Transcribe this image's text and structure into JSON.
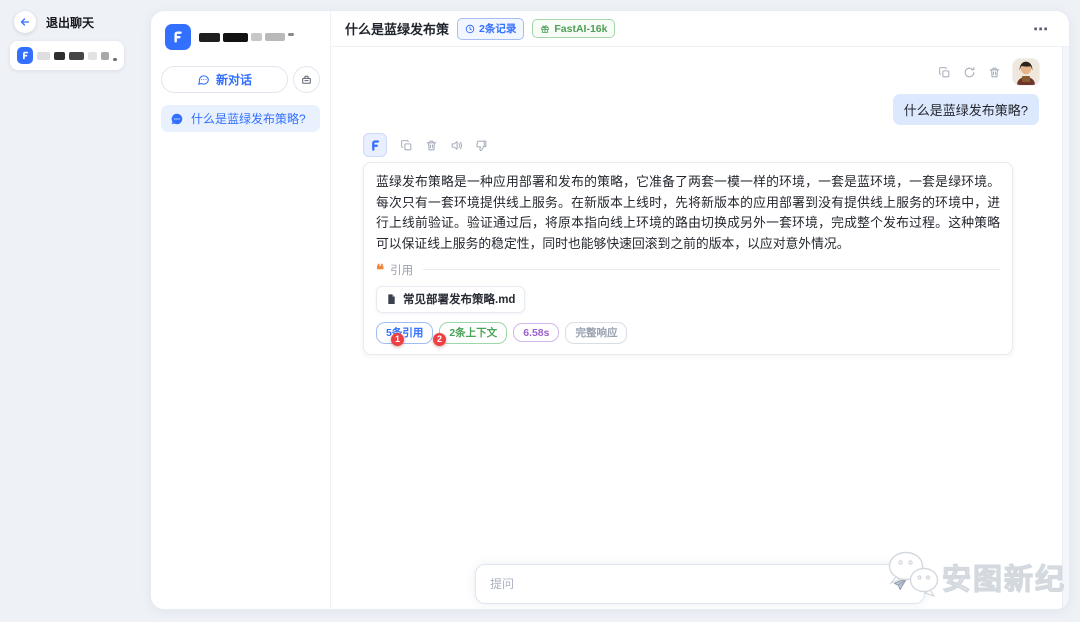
{
  "colors": {
    "accent_blue": "#3370ff",
    "badge_green": "#4f9e57",
    "badge_purple": "#9a5fd0",
    "badge_gray": "#9aa2b0",
    "marker_red": "#ee3f42",
    "user_bubble_bg": "#dbe8fd",
    "history_item_bg": "#e9f1fe",
    "page_bg": "#eef1f6"
  },
  "icons": {
    "back": "arrow-left-icon",
    "new_chat": "chat-bubble-icon",
    "clear": "box-icon",
    "history": "chat-bubble-filled-icon",
    "records": "clock-icon",
    "model": "gift-icon",
    "menu": "ellipsis-icon",
    "copy": "copy-icon",
    "retry": "refresh-icon",
    "delete": "trash-icon",
    "speak": "speaker-icon",
    "dislike": "thumbs-down-icon",
    "file": "document-icon",
    "send": "paper-plane-icon",
    "watermark": "wechat-bubbles-icon"
  },
  "left_rail": {
    "exit_label": "退出聊天"
  },
  "sidebar": {
    "new_chat_label": "新对话",
    "history": [
      {
        "label": "什么是蓝绿发布策略?"
      }
    ]
  },
  "header": {
    "title": "什么是蓝绿发布策",
    "records_badge": "2条记录",
    "model_badge": "FastAI-16k",
    "menu": "⋯"
  },
  "chat": {
    "user_message": "什么是蓝绿发布策略?",
    "assistant_message": "蓝绿发布策略是一种应用部署和发布的策略，它准备了两套一模一样的环境，一套是蓝环境，一套是绿环境。每次只有一套环境提供线上服务。在新版本上线时，先将新版本的应用部署到没有提供线上服务的环境中，进行上线前验证。验证通过后，将原本指向线上环境的路由切换成另外一套环境，完成整个发布过程。这种策略可以保证线上服务的稳定性，同时也能够快速回滚到之前的版本，以应对意外情况。",
    "quote_label": "引用",
    "citation_file": "常见部署发布策略.md",
    "meta_badges": [
      {
        "label": "5条引用",
        "marker": "1"
      },
      {
        "label": "2条上下文",
        "marker": "2"
      },
      {
        "label": "6.58s"
      },
      {
        "label": "完整响应"
      }
    ]
  },
  "composer": {
    "placeholder": "提问"
  },
  "watermark": {
    "text": "安图新纪"
  }
}
